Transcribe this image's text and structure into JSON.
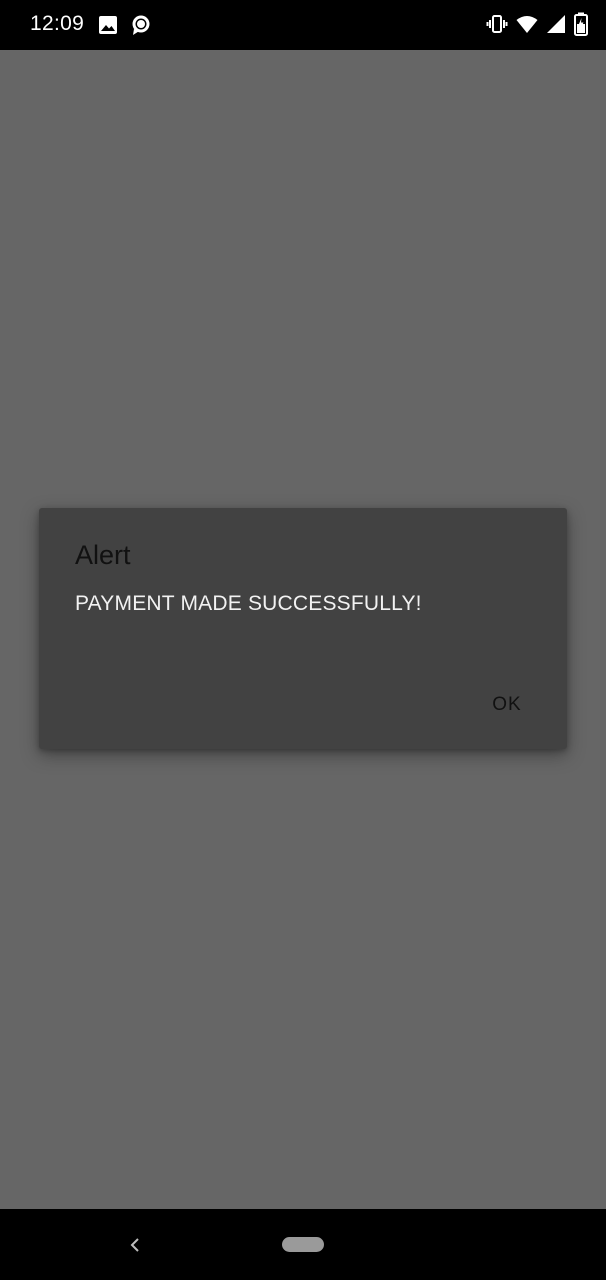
{
  "status_bar": {
    "time": "12:09",
    "left_icons": [
      "image-icon",
      "chat-bubble-icon"
    ],
    "right_icons": [
      "vibrate-icon",
      "wifi-icon",
      "signal-icon",
      "battery-charging-icon"
    ]
  },
  "dialog": {
    "title": "Alert",
    "message": "PAYMENT MADE SUCCESSFULLY!",
    "ok_label": "OK"
  },
  "nav_bar": {
    "icons": [
      "back-icon",
      "home-pill-icon"
    ]
  },
  "colors": {
    "scrim": "#666666",
    "dialog_background": "#424242",
    "status_bar": "#000000",
    "nav_bar": "#000000"
  }
}
